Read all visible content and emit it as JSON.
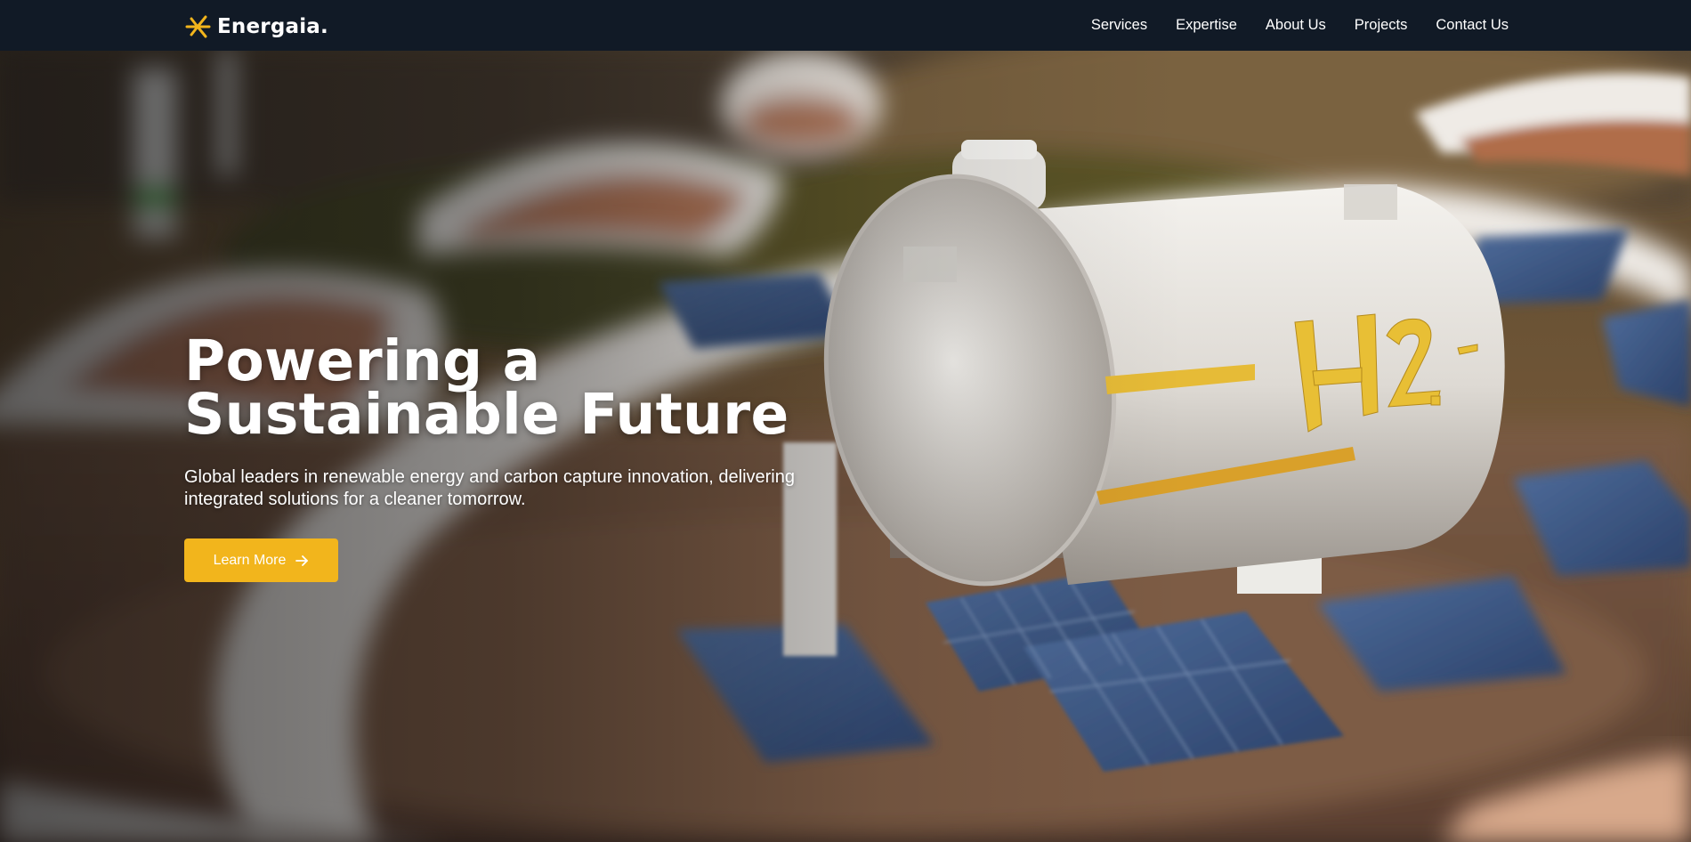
{
  "brand": {
    "name": "Energaia.",
    "logo_icon": "sun-spark-icon",
    "accent_color": "#f2b51c"
  },
  "nav": {
    "items": [
      {
        "label": "Services"
      },
      {
        "label": "Expertise"
      },
      {
        "label": "About Us"
      },
      {
        "label": "Projects"
      },
      {
        "label": "Contact Us"
      }
    ]
  },
  "hero": {
    "title": "Powering a Sustainable Future",
    "subtitle": "Global leaders in renewable energy and carbon capture innovation, delivering integrated solutions for a cleaner tomorrow.",
    "cta_label": "Learn More",
    "cta_icon": "arrow-right-icon",
    "background_image": "hydrogen-storage-tank-with-solar-panels",
    "tank_marking": "H2."
  },
  "colors": {
    "header_bg": "#111a26",
    "button_bg": "#f2b51c",
    "text": "#ffffff"
  }
}
